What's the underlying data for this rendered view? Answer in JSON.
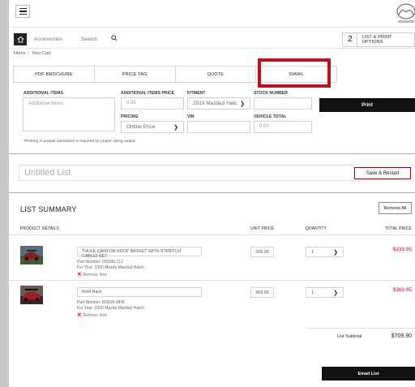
{
  "header": {
    "menu_icon": "hamburger-icon",
    "logo_icon": "mazda-logo"
  },
  "nav": {
    "home_icon": "home-icon",
    "accessories": "Accessories",
    "search": "Search",
    "search_icon": "magnifier-icon",
    "cart_count": "2",
    "cart_label": "LIST & PRINT OPTIONS"
  },
  "breadcrumb": {
    "home": "Home",
    "current": "Your Cart"
  },
  "tabs": [
    "PDF BROCHURE",
    "PRICE TAG",
    "QUOTE",
    "DIAWL"
  ],
  "print_form": {
    "additional_items_label": "ADDITIONAL ITEMS",
    "additional_items_placeholder": "Additional Items",
    "additional_price_label": "ADDITIONAL ITEMS PRICE",
    "additional_price_placeholder": "0.00",
    "fitment_label": "FITMENT",
    "fitment_value": "2019 Mazda3 Hatc",
    "stock_label": "STOCK NUMBER",
    "stock_value": "",
    "pricing_label": "PRICING",
    "pricing_value": "Online Price",
    "vin_label": "VIN",
    "vin_value": "",
    "vehicle_total_label": "VEHICLE TOTAL",
    "vehicle_total_placeholder": "0.00",
    "print_button": "Print",
    "note": "*Printing in portrait orientation is required for proper sizing output."
  },
  "list": {
    "name_placeholder": "Untitled List",
    "save_button": "Save & Restart"
  },
  "summary": {
    "title": "LIST SUMMARY",
    "remove_all": "Remove All",
    "columns": {
      "product": "PRODUCT DETAILS",
      "unit_price": "UNIT PRICE",
      "quantity": "QUANTITY",
      "total": "TOTAL PRICE"
    },
    "items": [
      {
        "name": "THULE CANYON ROOF BASKET WITH STRETCH CARGO NET",
        "part": "Part Number: 0000BLZ12",
        "for": "For Your: 2020 Mazda Mazda3 Hatch",
        "remove": "Remove Item",
        "unit_price": "339.95",
        "quantity": "1",
        "total": "$339.95"
      },
      {
        "name": "Roof Rack",
        "part": "Part Number: BDEW-3840",
        "for": "For Your: 2020 Mazda Mazda3 Hatch",
        "remove": "Remove Item",
        "unit_price": "369.95",
        "quantity": "1",
        "total": "$369.95"
      }
    ],
    "subtotal_label": "List Subtotal",
    "subtotal_value": "$709.90",
    "email_button": "Email List"
  },
  "colors": {
    "accent_red": "#c0101a",
    "price_red": "#b81c2c",
    "dark": "#111111"
  }
}
